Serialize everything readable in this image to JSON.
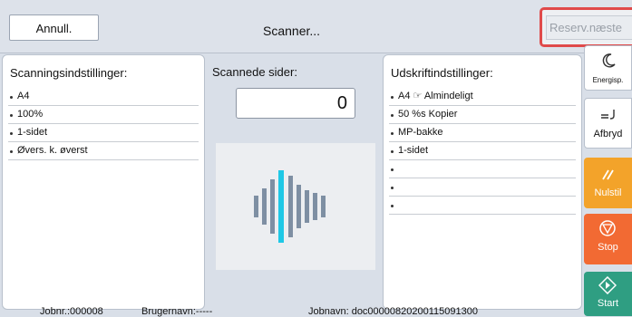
{
  "header": {
    "cancel_label": "Annull.",
    "title": "Scanner...",
    "reserve_label": "Reserv.næste"
  },
  "scan_settings": {
    "title": "Scanningsindstillinger:",
    "items": [
      "A4",
      "100%",
      "1-sidet",
      "Øvers. k. øverst"
    ]
  },
  "scanned_pages": {
    "title": "Scannede sider:",
    "count": "0"
  },
  "print_settings": {
    "title": "Udskriftindstillinger:",
    "items": [
      "A4 ☞ Almindeligt",
      "50  %s Kopier",
      "MP-bakke",
      "1-sidet",
      "",
      "",
      ""
    ]
  },
  "side_buttons": {
    "energy": "Energisp.",
    "interrupt": "Afbryd",
    "reset": "Nulstil",
    "stop": "Stop",
    "start": "Start"
  },
  "status_bar": {
    "job_no": "Jobnr.:000008",
    "user": "Brugernavn:-----",
    "job_name": "Jobnavn: doc00000820200115091300"
  },
  "colors": {
    "reset": "#f3a32a",
    "stop": "#f26a33",
    "start": "#2f9e82",
    "reserve_border": "#e04a4a",
    "scan_line": "#1ec8e6"
  }
}
